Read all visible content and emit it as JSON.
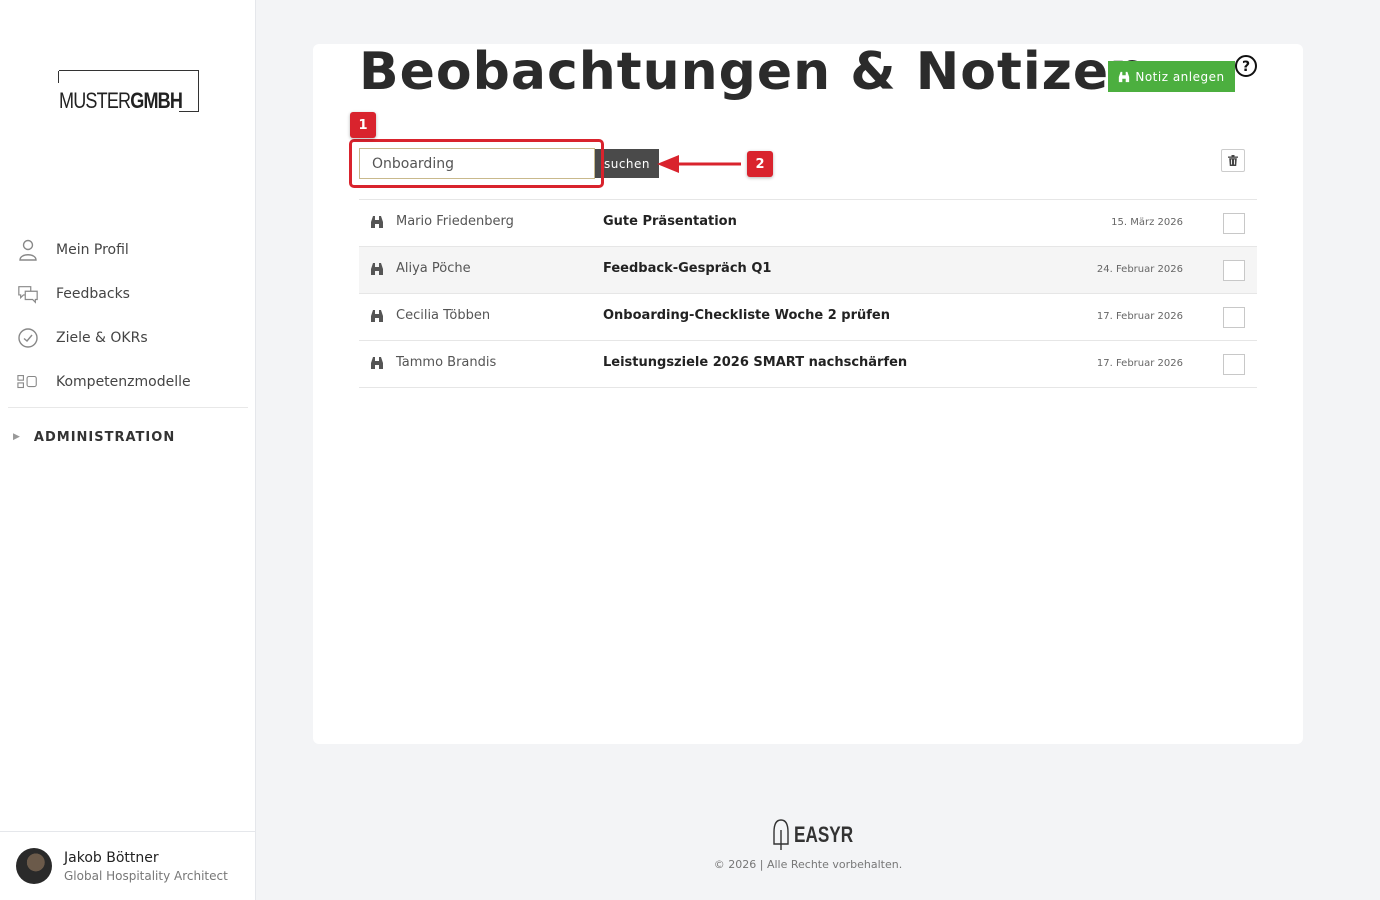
{
  "logo": {
    "light": "MUSTER",
    "bold": "GMBH"
  },
  "nav": {
    "items": [
      {
        "icon": "person-icon",
        "label": "Mein Profil"
      },
      {
        "icon": "chat-bubbles-icon",
        "label": "Feedbacks"
      },
      {
        "icon": "check-circle-icon",
        "label": "Ziele & OKRs"
      },
      {
        "icon": "competency-icon",
        "label": "Kompetenzmodelle"
      }
    ],
    "admin_label": "ADMINISTRATION"
  },
  "user": {
    "name": "Jakob Böttner",
    "role": "Global Hospitality Architect"
  },
  "page": {
    "title": "Beobachtungen & Notizen",
    "add_button": "Notiz anlegen"
  },
  "search": {
    "value": "Onboarding",
    "button": "suchen"
  },
  "notes": [
    {
      "person": "Mario Friedenberg",
      "title": "Gute Präsentation",
      "date": "15. März 2026"
    },
    {
      "person": "Aliya Pöche",
      "title": "Feedback-Gespräch Q1",
      "date": "24. Februar 2026"
    },
    {
      "person": "Cecilia Többen",
      "title": "Onboarding-Checkliste Woche 2 prüfen",
      "date": "17. Februar 2026"
    },
    {
      "person": "Tammo Brandis",
      "title": "Leistungsziele 2026 SMART nachschärfen",
      "date": "17. Februar 2026"
    }
  ],
  "annotations": {
    "badge1": "1",
    "badge2": "2"
  },
  "footer": {
    "brand": "EASYR",
    "copyright": "© 2026 | Alle Rechte vorbehalten."
  },
  "colors": {
    "accent_green": "#4caf3f",
    "annotation_red": "#d9232d",
    "dark_button": "#4a4a4a"
  }
}
